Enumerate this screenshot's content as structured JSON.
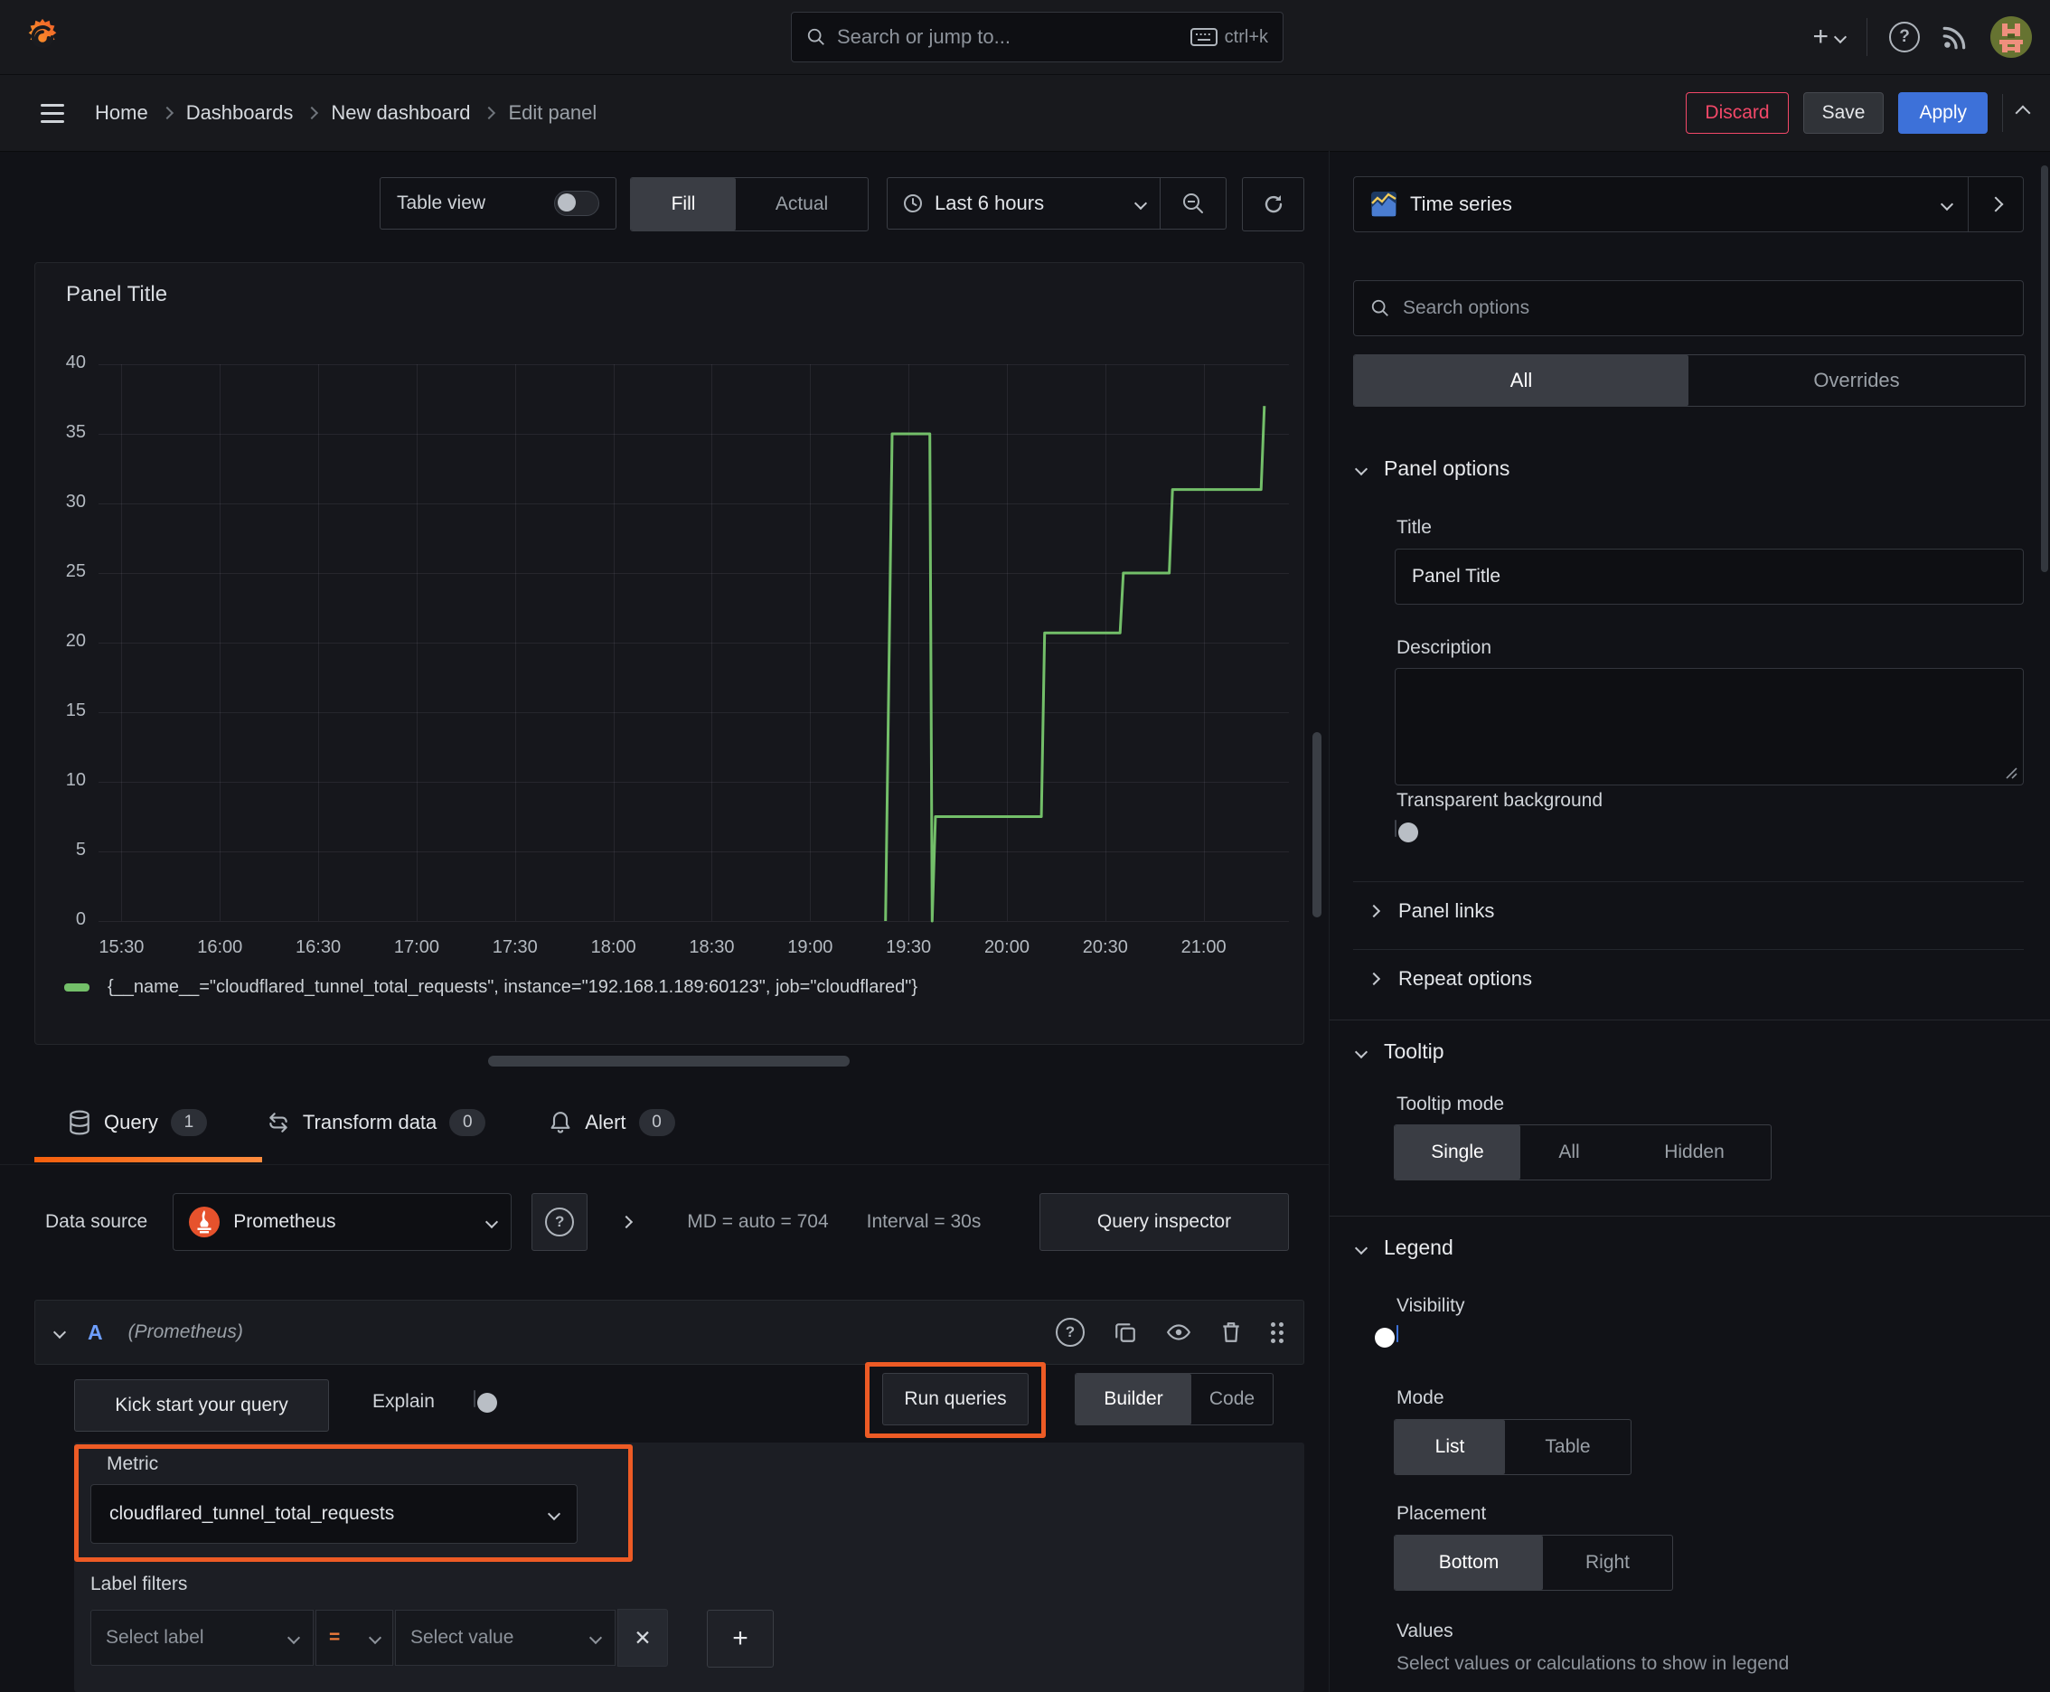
{
  "topbar": {
    "search_placeholder": "Search or jump to...",
    "shortcut": "ctrl+k"
  },
  "breadcrumb": {
    "items": [
      "Home",
      "Dashboards",
      "New dashboard",
      "Edit panel"
    ],
    "discard": "Discard",
    "save": "Save",
    "apply": "Apply"
  },
  "toolbar": {
    "table_view": "Table view",
    "fill": "Fill",
    "actual": "Actual",
    "time_range": "Last 6 hours"
  },
  "panel": {
    "title": "Panel Title"
  },
  "chart_data": {
    "type": "line",
    "title": "Panel Title",
    "x_tick_labels": [
      "15:30",
      "16:00",
      "16:30",
      "17:00",
      "17:30",
      "18:00",
      "18:30",
      "19:00",
      "19:30",
      "20:00",
      "20:30",
      "21:00"
    ],
    "x_tick_minutes": [
      0,
      30,
      60,
      90,
      120,
      150,
      180,
      210,
      240,
      270,
      300,
      330
    ],
    "x_domain_minutes": [
      -7,
      356
    ],
    "y_ticks": [
      0,
      5,
      10,
      15,
      20,
      25,
      30,
      35,
      40
    ],
    "ylim": [
      0,
      40
    ],
    "grid": true,
    "legend_position": "bottom",
    "series": [
      {
        "name": "{__name__=\"cloudflared_tunnel_total_requests\", instance=\"192.168.1.189:60123\", job=\"cloudflared\"}",
        "color": "#73bf69",
        "step_points_min_val": [
          [
            233,
            0
          ],
          [
            235,
            35
          ],
          [
            246.5,
            35
          ],
          [
            247.2,
            0
          ],
          [
            248.2,
            7.5
          ],
          [
            280.5,
            7.5
          ],
          [
            281.5,
            20.7
          ],
          [
            304.5,
            20.7
          ],
          [
            305.5,
            25
          ],
          [
            319.5,
            25
          ],
          [
            320.5,
            31
          ],
          [
            347.5,
            31
          ],
          [
            348.5,
            37
          ]
        ]
      }
    ]
  },
  "query": {
    "tabs": [
      {
        "label": "Query",
        "count": "1"
      },
      {
        "label": "Transform data",
        "count": "0"
      },
      {
        "label": "Alert",
        "count": "0"
      }
    ],
    "datasource_label": "Data source",
    "datasource_name": "Prometheus",
    "max_data_points": "MD = auto = 704",
    "interval": "Interval = 30s",
    "query_inspector": "Query inspector",
    "row": {
      "ref": "A",
      "datasource": "(Prometheus)"
    },
    "kick_start": "Kick start your query",
    "explain": "Explain",
    "run_queries": "Run queries",
    "builder": "Builder",
    "code": "Code",
    "metric_label": "Metric",
    "metric_value": "cloudflared_tunnel_total_requests",
    "label_filters_label": "Label filters",
    "select_label_placeholder": "Select label",
    "operator": "=",
    "select_value_placeholder": "Select value"
  },
  "sidebar": {
    "visualization": "Time series",
    "search_placeholder": "Search options",
    "tab_all": "All",
    "tab_overrides": "Overrides",
    "panel_options": {
      "heading": "Panel options",
      "title_label": "Title",
      "title_value": "Panel Title",
      "description_label": "Description",
      "transparent_label": "Transparent background"
    },
    "collapsed": {
      "panel_links": "Panel links",
      "repeat_options": "Repeat options"
    },
    "tooltip": {
      "heading": "Tooltip",
      "mode_label": "Tooltip mode",
      "options": [
        "Single",
        "All",
        "Hidden"
      ],
      "selected": "Single"
    },
    "legend": {
      "heading": "Legend",
      "visibility_label": "Visibility",
      "mode_label": "Mode",
      "mode_options": [
        "List",
        "Table"
      ],
      "mode_selected": "List",
      "placement_label": "Placement",
      "placement_options": [
        "Bottom",
        "Right"
      ],
      "placement_selected": "Bottom",
      "values_label": "Values",
      "values_hint": "Select values or calculations to show in legend"
    }
  },
  "colors": {
    "accent_orange": "#ed5b25",
    "tab_underline": "#ff780a",
    "series_green": "#73bf69",
    "primary_blue": "#3d71d9",
    "destructive": "#f24868"
  }
}
